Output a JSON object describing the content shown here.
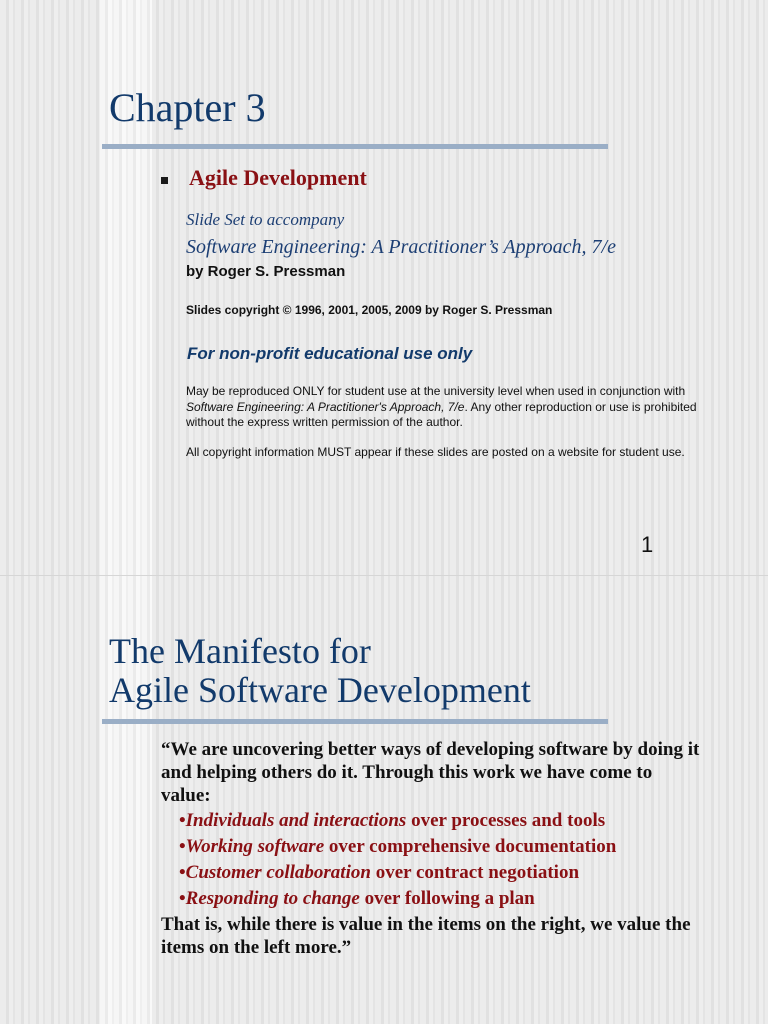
{
  "slide1": {
    "title": "Chapter 3",
    "heading": "Agile Development",
    "slide_set": "Slide Set to accompany",
    "book_title": "Software Engineering: A Practitioner’s Approach, 7/e",
    "author": "by Roger S. Pressman",
    "copyright": "Slides copyright © 1996, 2001, 2005, 2009 by Roger S. Pressman",
    "nonprofit": "For non-profit educational use only",
    "para1_pre": "May be reproduced ONLY for student use at the university level when used in conjunction with ",
    "para1_book": "Software Engineering: A Practitioner's Approach, 7/e",
    "para1_post": ". Any other reproduction or use is prohibited without the express written permission of the author.",
    "para2": "All copyright information MUST appear if these slides are posted on a website for student use.",
    "page_number": "1"
  },
  "slide2": {
    "title_line1": "The Manifesto for",
    "title_line2": "Agile Software Development",
    "intro": "“We are uncovering better ways of developing software by doing it and helping others do it.  Through this work we have come to value:",
    "items": [
      {
        "bullet": "•",
        "left": "Individuals and interactions",
        "right": " over processes and tools"
      },
      {
        "bullet": "•",
        "left": "Working software",
        "right": " over comprehensive documentation"
      },
      {
        "bullet": "•",
        "left": "Customer collaboration",
        "right": " over contract negotiation"
      },
      {
        "bullet": "•",
        "left": "Responding to change",
        "right": " over following a plan"
      }
    ],
    "closing": "That is, while there is value in the items on the right, we value the items on the left more.”"
  },
  "colors": {
    "title_blue": "#123a6b",
    "accent_red": "#8a1014",
    "rule_blue": "#9aaec6"
  }
}
